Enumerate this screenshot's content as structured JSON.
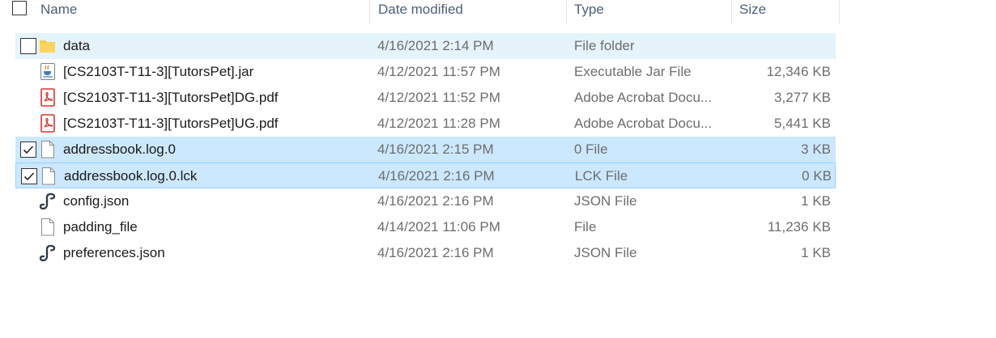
{
  "header": {
    "name": "Name",
    "date_modified": "Date modified",
    "type": "Type",
    "size": "Size"
  },
  "files": [
    {
      "name": "data",
      "date": "4/16/2021 2:14 PM",
      "type": "File folder",
      "size": "",
      "icon": "folder-icon",
      "state": "hover",
      "checked": false
    },
    {
      "name": "[CS2103T-T11-3][TutorsPet].jar",
      "date": "4/12/2021 11:57 PM",
      "type": "Executable Jar File",
      "size": "12,346 KB",
      "icon": "jar-icon",
      "state": "normal",
      "checked": false
    },
    {
      "name": "[CS2103T-T11-3][TutorsPet]DG.pdf",
      "date": "4/12/2021 11:52 PM",
      "type": "Adobe Acrobat Docu...",
      "size": "3,277 KB",
      "icon": "pdf-icon",
      "state": "normal",
      "checked": false
    },
    {
      "name": "[CS2103T-T11-3][TutorsPet]UG.pdf",
      "date": "4/12/2021 11:28 PM",
      "type": "Adobe Acrobat Docu...",
      "size": "5,441 KB",
      "icon": "pdf-icon",
      "state": "normal",
      "checked": false
    },
    {
      "name": "addressbook.log.0",
      "date": "4/16/2021 2:15 PM",
      "type": "0 File",
      "size": "3 KB",
      "icon": "file-icon",
      "state": "selected",
      "checked": true
    },
    {
      "name": "addressbook.log.0.lck",
      "date": "4/16/2021 2:16 PM",
      "type": "LCK File",
      "size": "0 KB",
      "icon": "file-icon",
      "state": "focused",
      "checked": true
    },
    {
      "name": "config.json",
      "date": "4/16/2021 2:16 PM",
      "type": "JSON File",
      "size": "1 KB",
      "icon": "json-icon",
      "state": "normal",
      "checked": false
    },
    {
      "name": "padding_file",
      "date": "4/14/2021 11:06 PM",
      "type": "File",
      "size": "11,236 KB",
      "icon": "file-icon",
      "state": "normal",
      "checked": false
    },
    {
      "name": "preferences.json",
      "date": "4/16/2021 2:16 PM",
      "type": "JSON File",
      "size": "1 KB",
      "icon": "json-icon",
      "state": "normal",
      "checked": false
    }
  ],
  "colors": {
    "hover": "#e5f3fb",
    "selected": "#cce8ff",
    "focus_border": "#99d1ff",
    "header_text": "#4c607a",
    "folder": "#f8c945"
  }
}
